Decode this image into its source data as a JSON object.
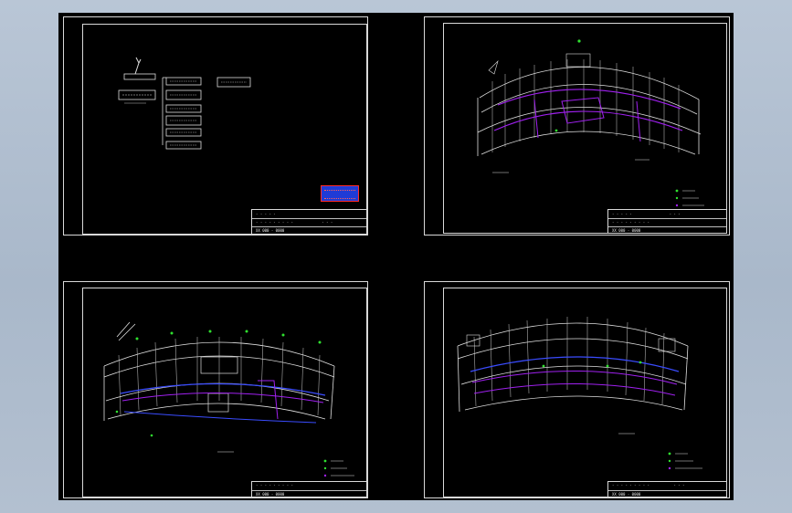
{
  "colors": {
    "background": "#b3c0d0",
    "canvas": "#000000",
    "linework": "#e0e0e0",
    "route": "#a020f0",
    "route_alt": "#3a4cff",
    "marker_green": "#2fe02f",
    "stamp_blue": "#1f3bd6",
    "stamp_red": "#ff2a2a"
  },
  "sheets": [
    {
      "name": "system-diagram",
      "drawing_no": "XX 000 - 0000"
    },
    {
      "name": "floor-plan-upper",
      "drawing_no": "XX 000 - 0000"
    },
    {
      "name": "floor-plan-ground",
      "drawing_no": "XX 000 - 0000"
    },
    {
      "name": "floor-plan-typical",
      "drawing_no": "XX 000 - 0000"
    }
  ]
}
